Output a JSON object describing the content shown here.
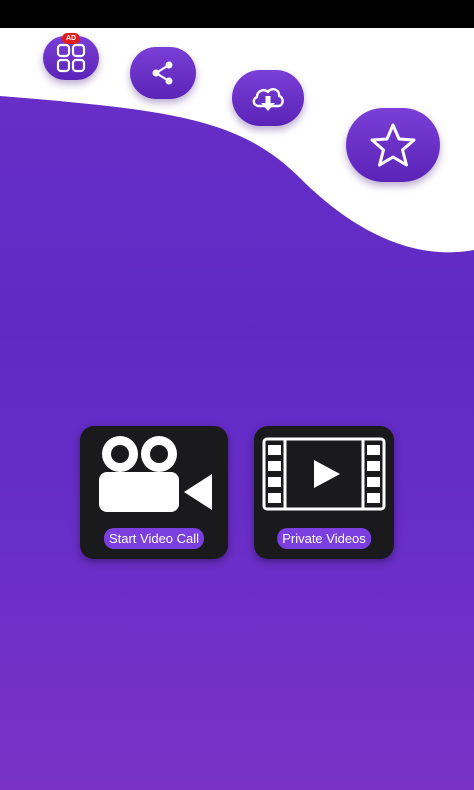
{
  "top_actions": {
    "apps": {
      "icon": "apps-grid-icon",
      "badge": "AD"
    },
    "share": {
      "icon": "share-icon"
    },
    "download": {
      "icon": "cloud-download-icon"
    },
    "rate": {
      "icon": "star-icon"
    }
  },
  "main": {
    "cards": [
      {
        "label": "Start Video Call",
        "icon": "video-camera-icon"
      },
      {
        "label": "Private Videos",
        "icon": "film-play-icon"
      }
    ]
  },
  "colors": {
    "primary": "#6a2fc8",
    "card_bg": "#1a1a1c",
    "label_bg": "#7b3fe0",
    "badge": "#e01e1e"
  }
}
